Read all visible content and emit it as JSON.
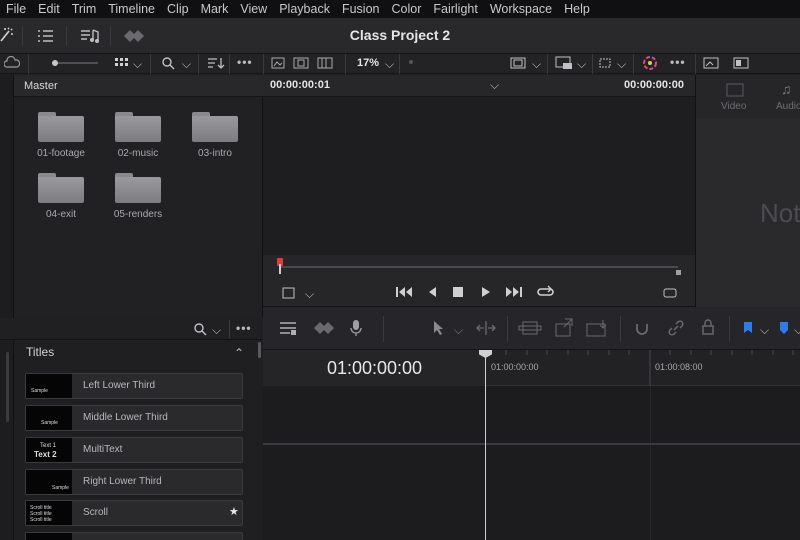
{
  "menu": [
    "File",
    "Edit",
    "Trim",
    "Timeline",
    "Clip",
    "Mark",
    "View",
    "Playback",
    "Fusion",
    "Color",
    "Fairlight",
    "Workspace",
    "Help"
  ],
  "project_title": "Class Project 2",
  "viewer": {
    "zoom": "17%",
    "timecode_left": "00:00:00:01",
    "timecode_right": "00:00:00:00"
  },
  "media_pool": {
    "header": "Master",
    "folders": [
      "01-footage",
      "02-music",
      "03-intro",
      "04-exit",
      "05-renders"
    ]
  },
  "inspector": {
    "tabs": [
      "Video",
      "Audio"
    ],
    "placeholder": "Not"
  },
  "effects": {
    "section": "Titles",
    "items": [
      {
        "name": "Left Lower Third",
        "thumb": [
          "Sample"
        ]
      },
      {
        "name": "Middle Lower Third",
        "thumb": [
          "Sample"
        ]
      },
      {
        "name": "MultiText",
        "thumb": [
          "Text 1",
          "Text 2"
        ]
      },
      {
        "name": "Right Lower Third",
        "thumb": [
          "Sample"
        ]
      },
      {
        "name": "Scroll",
        "thumb": [
          "Scroll title",
          "Scroll title",
          "Scroll title"
        ]
      },
      {
        "name": "",
        "thumb": []
      }
    ]
  },
  "timeline": {
    "timecode": "01:00:00:00",
    "ruler": [
      "01:00:00:00",
      "01:00:08:00"
    ]
  }
}
